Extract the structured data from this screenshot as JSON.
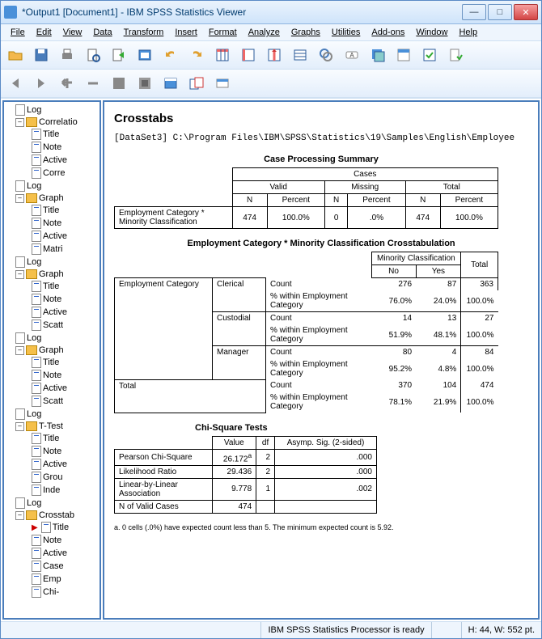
{
  "window": {
    "title": "*Output1 [Document1] - IBM SPSS Statistics Viewer"
  },
  "menu": [
    "File",
    "Edit",
    "View",
    "Data",
    "Transform",
    "Insert",
    "Format",
    "Analyze",
    "Graphs",
    "Utilities",
    "Add-ons",
    "Window",
    "Help"
  ],
  "outline": {
    "items": [
      {
        "type": "log",
        "label": "Log"
      },
      {
        "type": "book",
        "label": "Correlatio",
        "children": [
          "Title",
          "Note",
          "Active",
          "Corre"
        ]
      },
      {
        "type": "log",
        "label": "Log"
      },
      {
        "type": "book",
        "label": "Graph",
        "children": [
          "Title",
          "Note",
          "Active",
          "Matri"
        ]
      },
      {
        "type": "log",
        "label": "Log"
      },
      {
        "type": "book",
        "label": "Graph",
        "children": [
          "Title",
          "Note",
          "Active",
          "Scatt"
        ]
      },
      {
        "type": "log",
        "label": "Log"
      },
      {
        "type": "book",
        "label": "Graph",
        "children": [
          "Title",
          "Note",
          "Active",
          "Scatt"
        ]
      },
      {
        "type": "log",
        "label": "Log"
      },
      {
        "type": "book",
        "label": "T-Test",
        "children": [
          "Title",
          "Note",
          "Active",
          "Grou",
          "Inde"
        ]
      },
      {
        "type": "log",
        "label": "Log"
      },
      {
        "type": "book",
        "label": "Crosstab",
        "children": [
          "Title",
          "Note",
          "Active",
          "Case",
          "Emp",
          "Chi-"
        ],
        "active": 0
      }
    ]
  },
  "content": {
    "heading": "Crosstabs",
    "dataset_line": "[DataSet3] C:\\Program Files\\IBM\\SPSS\\Statistics\\19\\Samples\\English\\Employee",
    "cps": {
      "title": "Case Processing Summary",
      "row_label": "Employment Category * Minority Classification",
      "header_cases": "Cases",
      "header_valid": "Valid",
      "header_missing": "Missing",
      "header_total": "Total",
      "header_n": "N",
      "header_percent": "Percent",
      "valid_n": "474",
      "valid_pct": "100.0%",
      "miss_n": "0",
      "miss_pct": ".0%",
      "total_n": "474",
      "total_pct": "100.0%"
    },
    "crosstab": {
      "title": "Employment Category * Minority Classification Crosstabulation",
      "col_group": "Minority Classification",
      "col_no": "No",
      "col_yes": "Yes",
      "col_total": "Total",
      "row_group": "Employment Category",
      "stat_count": "Count",
      "stat_pct": "% within Employment Category",
      "cat1": "Clerical",
      "c1_no": "276",
      "c1_yes": "87",
      "c1_tot": "363",
      "c1p_no": "76.0%",
      "c1p_yes": "24.0%",
      "c1p_tot": "100.0%",
      "cat2": "Custodial",
      "c2_no": "14",
      "c2_yes": "13",
      "c2_tot": "27",
      "c2p_no": "51.9%",
      "c2p_yes": "48.1%",
      "c2p_tot": "100.0%",
      "cat3": "Manager",
      "c3_no": "80",
      "c3_yes": "4",
      "c3_tot": "84",
      "c3p_no": "95.2%",
      "c3p_yes": "4.8%",
      "c3p_tot": "100.0%",
      "row_total": "Total",
      "t_no": "370",
      "t_yes": "104",
      "t_tot": "474",
      "tp_no": "78.1%",
      "tp_yes": "21.9%",
      "tp_tot": "100.0%"
    },
    "chisq": {
      "title": "Chi-Square Tests",
      "h_value": "Value",
      "h_df": "df",
      "h_sig": "Asymp. Sig. (2-sided)",
      "r1": "Pearson Chi-Square",
      "r1v": "26.172",
      "r1sup": "a",
      "r1df": "2",
      "r1sig": ".000",
      "r2": "Likelihood Ratio",
      "r2v": "29.436",
      "r2df": "2",
      "r2sig": ".000",
      "r3": "Linear-by-Linear Association",
      "r3v": "9.778",
      "r3df": "1",
      "r3sig": ".002",
      "r4": "N of Valid Cases",
      "r4v": "474",
      "footnote": "a. 0 cells (.0%) have expected count less than 5. The minimum expected count is 5.92."
    }
  },
  "status": {
    "ready": "IBM SPSS Statistics Processor is ready",
    "dims": "H: 44, W: 552 pt."
  }
}
